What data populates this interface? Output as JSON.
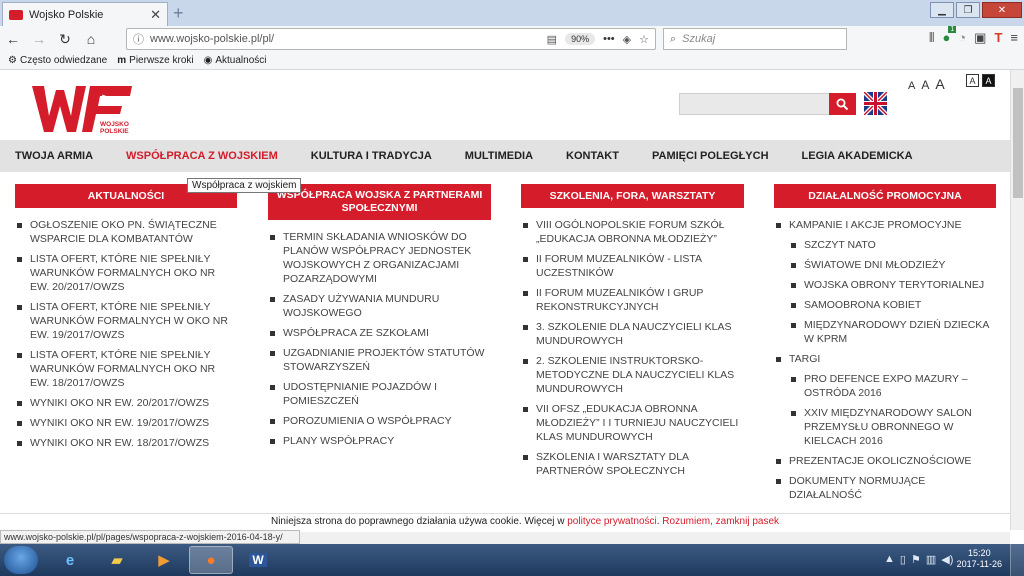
{
  "browser": {
    "tab_title": "Wojsko Polskie",
    "tab_close": "✕",
    "new_tab": "+",
    "url": "www.wojsko-polskie.pl/pl/",
    "zoom": "90%",
    "search_placeholder": "Szukaj",
    "bookmarks": [
      "Często odwiedzane",
      "Pierwsze kroki",
      "Aktualności"
    ],
    "status_url": "www.wojsko-polskie.pl/pl/pages/wspopraca-z-wojskiem-2016-04-18-y/",
    "badge": "1"
  },
  "site": {
    "logo_text": "WOJSKO POLSKIE",
    "font_sizes": [
      "A",
      "A",
      "A"
    ],
    "contrast": [
      "A",
      "A"
    ],
    "nav": [
      "Twoja armia",
      "Współpraca z wojskiem",
      "Kultura i tradycja",
      "Multimedia",
      "Kontakt",
      "Pamięci poległych",
      "Legia Akademicka"
    ],
    "tooltip": "Współpraca z wojskiem"
  },
  "columns": [
    {
      "title": "Aktualności",
      "items": [
        "Ogłoszenie OKO pn. Świąteczne wsparcie dla kombatantów",
        "Lista ofert, które nie spełniły warunków formalnych OKO nr ew. 20/2017/OWZS",
        "Lista ofert, które nie spełniły warunków formalnych w OKO nr ew. 19/2017/OWZS",
        "Lista ofert, które nie spełniły warunków formalnych OKO nr ew. 18/2017/OWZS",
        "Wyniki OKO nr ew. 20/2017/OWZS",
        "Wyniki OKO nr ew. 19/2017/OWZS",
        "Wyniki OKO nr ew. 18/2017/OWZS"
      ]
    },
    {
      "title": "Współpraca wojska z partnerami społecznymi",
      "items": [
        "Termin składania wniosków do planów współpracy jednostek wojskowych z organizacjami pozarządowymi",
        "Zasady używania munduru wojskowego",
        "Współpraca ze szkołami",
        "Uzgadnianie projektów statutów stowarzyszeń",
        "Udostępnianie pojazdów i pomieszczeń",
        "Porozumienia o współpracy",
        "Plany współpracy"
      ]
    },
    {
      "title": "Szkolenia, fora, warsztaty",
      "items": [
        "VIII Ogólnopolskie Forum Szkół „Edukacja Obronna Młodzieży”",
        "II Forum Muzealników - lista uczestników",
        "II Forum Muzealników i Grup Rekonstrukcyjnych",
        "3. Szkolenie dla nauczycieli klas mundurowych",
        "2. Szkolenie instruktorsko-metodyczne dla nauczycieli klas mundurowych",
        "VII OFSZ „Edukacja Obronna Młodzieży” i I Turnieju Nauczycieli Klas Mundurowych",
        "Szkolenia i warsztaty dla partnerów społecznych"
      ]
    },
    {
      "title": "Działalność promocyjna",
      "items": [
        "Kampanie i akcje promocyjne",
        "Szczyt NATO",
        "Światowe Dni Młodzieży",
        "Wojska Obrony Terytorialnej",
        "Samoobrona kobiet",
        "Międzynarodowy Dzień Dziecka w KPRM",
        "Targi",
        "Pro Defence Expo Mazury – Ostróda 2016",
        "XXIV Międzynarodowy Salon Przemysłu Obronnego w Kielcach 2016",
        "Prezentacje okolicznościowe",
        "Dokumenty normujące działalność"
      ],
      "sub": [
        false,
        true,
        true,
        true,
        true,
        true,
        false,
        true,
        true,
        false,
        false
      ]
    }
  ],
  "cookie": {
    "text": "Niniejsza strona do poprawnego działania używa cookie. Więcej w ",
    "link": "polityce prywatności",
    "close": "Rozumiem, zamknij pasek"
  },
  "taskbar": {
    "time": "15:20",
    "date": "2017-11-26"
  },
  "colors": {
    "brand_red": "#d41c2b"
  }
}
